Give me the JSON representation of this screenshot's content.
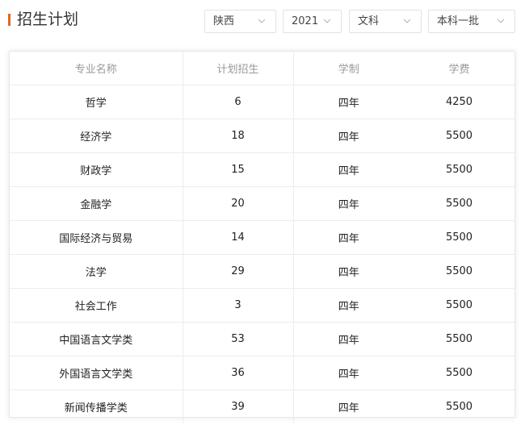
{
  "header": {
    "title": "招生计划"
  },
  "filters": {
    "province": "陕西",
    "year": "2021",
    "subject": "文科",
    "batch": "本科一批"
  },
  "table": {
    "columns": [
      "专业名称",
      "计划招生",
      "学制",
      "学费"
    ],
    "rows": [
      [
        "哲学",
        "6",
        "四年",
        "4250"
      ],
      [
        "经济学",
        "18",
        "四年",
        "5500"
      ],
      [
        "财政学",
        "15",
        "四年",
        "5500"
      ],
      [
        "金融学",
        "20",
        "四年",
        "5500"
      ],
      [
        "国际经济与贸易",
        "14",
        "四年",
        "5500"
      ],
      [
        "法学",
        "29",
        "四年",
        "5500"
      ],
      [
        "社会工作",
        "3",
        "四年",
        "5500"
      ],
      [
        "中国语言文学类",
        "53",
        "四年",
        "5500"
      ],
      [
        "外国语言文学类",
        "36",
        "四年",
        "5500"
      ],
      [
        "新闻传播学类",
        "39",
        "四年",
        "5500"
      ]
    ]
  },
  "icons": {
    "dropdown": "chevron-down-icon"
  },
  "colors": {
    "accent": "#e8641b"
  }
}
